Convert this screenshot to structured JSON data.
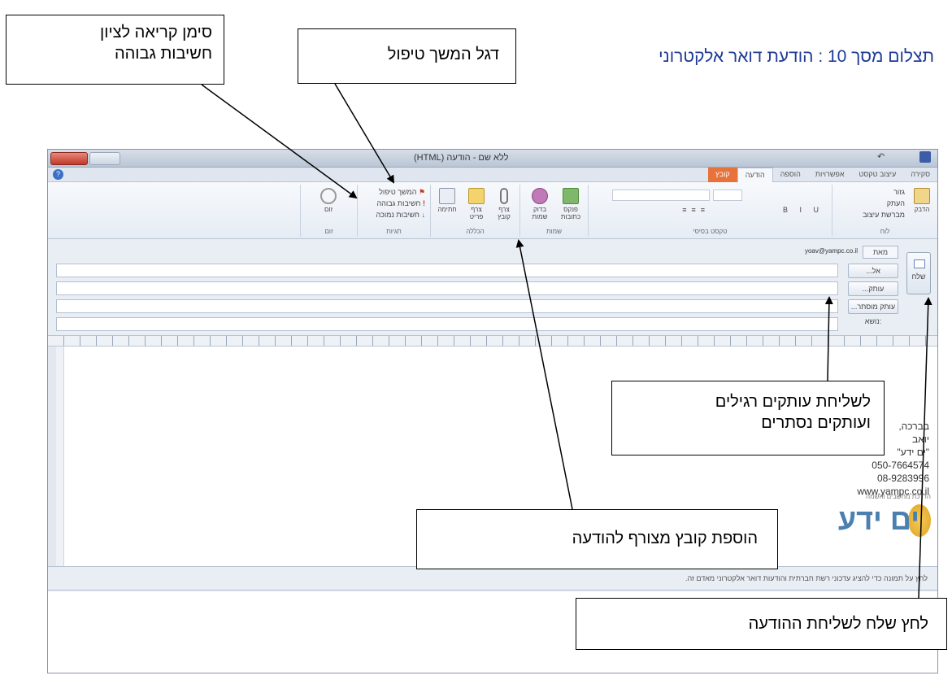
{
  "caption": "תצלום מסך 10 : הודעת דואר אלקטרוני",
  "callouts": {
    "high_importance": [
      "סימן קריאה לציון",
      "חשיבות גבוהה"
    ],
    "follow_up_flag": "דגל המשך טיפול",
    "cc_bcc": [
      "לשליחת עותקים רגילים",
      "ועותקים נסתרים"
    ],
    "attach_file": "הוספת קובץ מצורף להודעה",
    "send": "לחץ שלח לשליחת ההודעה"
  },
  "window": {
    "title": "ללא שם - הודעה (HTML)"
  },
  "ribbon_tabs": [
    "קובץ",
    "הודעה",
    "הוספה",
    "אפשרויות",
    "עיצוב טקסט",
    "סקירה"
  ],
  "ribbon": {
    "clipboard_label": "לוח",
    "paste": "הדבק",
    "cut": "גזור",
    "copy": "העתק",
    "format_painter": "מברשת עיצוב",
    "basic_text_label": "טקסט בסיסי",
    "names_label": "שמות",
    "address_book": "פנקס כתובות",
    "check_names": "בדוק שמות",
    "include_label": "הכללה",
    "attach_file": "צרף קובץ",
    "attach_item": "צרף פריט",
    "signature": "חתימה",
    "tags_label": "תגיות",
    "follow_up": "המשך טיפול",
    "high_importance": "חשיבות גבוהה",
    "low_importance": "חשיבות נמוכה",
    "zoom_label": "זום",
    "zoom": "זום"
  },
  "header_fields": {
    "send": "שלח",
    "from": "מאת",
    "from_value": "yoav@yampc.co.il",
    "to": "אל...",
    "cc": "עותק...",
    "bcc": "עותק מוסתר...",
    "subject": "נושא:"
  },
  "signature_lines": [
    "בברכה,",
    "יואב",
    "\"ים ידע\"",
    "050-7664574",
    "08-9283996",
    "www.yampc.co.il"
  ],
  "logo": {
    "subtitle": "הדרכת מחשבים והשמה",
    "name": "ים ידע"
  },
  "people_pane_text": "לחץ על תמונה כדי להציג עדכוני רשת חברתית והודעות דואר אלקטרוני מאדם זה."
}
